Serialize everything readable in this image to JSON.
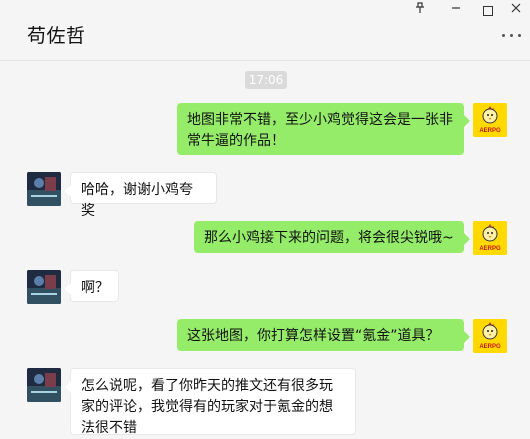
{
  "window": {
    "title": "苟佐哲",
    "pin_icon": "pin-icon",
    "minimize_icon": "minimize-icon",
    "maximize_icon": "maximize-icon",
    "close_icon": "close-icon",
    "more_icon": "more-icon"
  },
  "chat": {
    "timestamp": "17:06",
    "messages": [
      {
        "side": "right",
        "text": "地图非常不错，至少小鸡觉得这会是一张非常牛逼的作品！"
      },
      {
        "side": "left",
        "text": "哈哈，谢谢小鸡夸奖"
      },
      {
        "side": "right",
        "text": "那么小鸡接下来的问题，将会很尖锐哦~"
      },
      {
        "side": "left",
        "text": "啊？"
      },
      {
        "side": "right",
        "text": "这张地图，你打算怎样设置“氪金”道具？"
      },
      {
        "side": "left",
        "text": "怎么说呢，看了你昨天的推文还有很多玩家的评论，我觉得有的玩家对于氪金的想法很不错"
      }
    ],
    "right_avatar_logo_text": "AERPG"
  },
  "colors": {
    "sent_bubble": "#95ec69",
    "received_bubble": "#ffffff",
    "background": "#f5f5f5",
    "right_avatar": "#ffd900"
  }
}
